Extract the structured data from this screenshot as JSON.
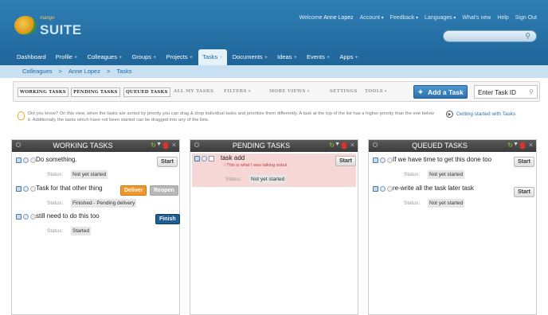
{
  "header": {
    "logo_small": "mango",
    "logo_big": "SUITE",
    "welcome": "Welcome",
    "user_name": "Anne Lopez",
    "links": [
      "Account",
      "Feedback",
      "Languages",
      "What's new",
      "Help",
      "Sign Out"
    ]
  },
  "nav": {
    "items": [
      "Dashboard",
      "Profile",
      "Colleagues",
      "Groups",
      "Projects",
      "Tasks",
      "Documents",
      "Ideas",
      "Events",
      "Apps"
    ],
    "active": "Tasks"
  },
  "breadcrumb": [
    "Colleagues",
    ">",
    "Anne Lopez",
    ">",
    "Tasks"
  ],
  "toolbar": {
    "views": [
      "WORKING TASKS",
      "PENDING TASKS",
      "QUEUED TASKS"
    ],
    "all_my_tasks": "ALL MY TASKS",
    "filters": "FILTERS",
    "more_views": "MORE VIEWS",
    "settings": "SETTINGS",
    "tools": "TOOLS",
    "add_task": "Add a Task",
    "task_id_placeholder": "Enter Task ID"
  },
  "tip": {
    "text": "Did you know? On this view, when the tasks are sorted by priority you can drag & drop individual tasks and prioritize them differently. A task at the top of the list has a higher priority than the one below it. Additionally the tasks which have not been started can be dragged into any of the lists.",
    "getting_started": "Getting started with Tasks"
  },
  "columns": [
    {
      "title": "WORKING TASKS",
      "tasks": [
        {
          "name": "Do something.",
          "status_label": "Status:",
          "status": "Not yet started",
          "buttons": [
            "Start"
          ]
        },
        {
          "name": "Task for that other thing",
          "status_label": "Status:",
          "status": "Finished - Pending delivery",
          "buttons": [
            "Deliver",
            "Reopen"
          ]
        },
        {
          "name": "still need to do this too",
          "status_label": "Status:",
          "status": "Started",
          "buttons": [
            "Finish"
          ]
        }
      ]
    },
    {
      "title": "PENDING TASKS",
      "tasks": [
        {
          "name": "task add",
          "note": "This is what I was talking aobut",
          "status_label": "Status:",
          "status": "Not yet started",
          "buttons": [
            "Start"
          ]
        }
      ]
    },
    {
      "title": "QUEUED TASKS",
      "tasks": [
        {
          "name": "If we have time to get this done too",
          "status_label": "Status:",
          "status": "Not yet started",
          "buttons": [
            "Start"
          ]
        },
        {
          "name": "re-write all the task later task",
          "status_label": "Status:",
          "status": "Not yet started",
          "buttons": [
            "Start"
          ]
        }
      ]
    }
  ],
  "colors": {
    "header": "#1f6599",
    "breadcrumb_bg": "#c8e0f1",
    "deliver": "#f0962a",
    "finish": "#1d5f93",
    "pending_highlight": "#f7d6d6"
  },
  "icons": [
    "search-icon",
    "add-icon",
    "bulb-icon",
    "play-icon",
    "refresh-icon",
    "filter-icon",
    "pdf-icon",
    "close-icon",
    "note-icon",
    "info-icon",
    "clock-icon"
  ]
}
